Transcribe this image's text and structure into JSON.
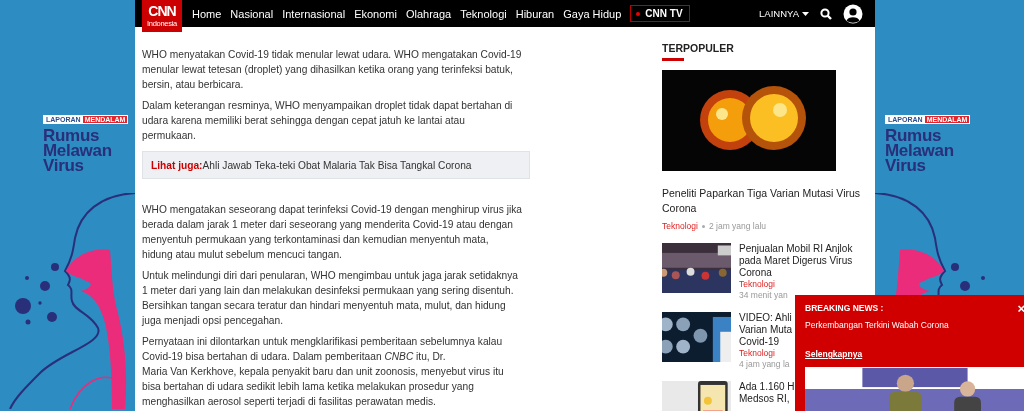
{
  "ad_left": {
    "badge": [
      "LAPORAN",
      "MENDALAM"
    ],
    "title": "Rumus\nMelawan\nVirus"
  },
  "nav": {
    "logo": {
      "brand": "CNN",
      "region": "Indonesia"
    },
    "items": [
      "Home",
      "Nasional",
      "Internasional",
      "Ekonomi",
      "Olahraga",
      "Teknologi",
      "Hiburan",
      "Gaya Hidup"
    ],
    "live": "CNN TV",
    "more": "LAINNYA"
  },
  "article": {
    "paragraphs_top": [
      "WHO menyatakan Covid-19 tidak menular lewat udara. WHO mengatakan Covid-19\nmenular lewat tetesan (droplet) yang dihasilkan ketika orang yang terinfeksi batuk,\nbersin, atau berbicara.",
      "Dalam keterangan resminya, WHO menyampaikan droplet  tidak dapat bertahan di\nudara karena memiliki berat sehingga dengan cepat jatuh ke lantai atau\npermukaan."
    ],
    "see_also": {
      "label": "Lihat juga:",
      "link": "Ahli Jawab Teka-teki Obat Malaria Tak Bisa Tangkal Corona"
    },
    "paragraphs_bottom": [
      "WHO mengatakan seseorang dapat terinfeksi Covid-19 dengan menghirup virus jika\nberada dalam jarak 1 meter dari seseorang yang menderita Covid-19 atau dengan\nmenyentuh permukaan yang terkontaminasi dan kemudian menyentuh mata,\nhidung atau mulut sebelum mencuci tangan.",
      "Untuk melindungi diri dari penularan, WHO mengimbau untuk jaga jarak setidaknya\n1 meter dari yang lain dan melakukan desinfeksi permukaan yang sering disentuh.\nBersihkan tangan secara teratur dan hindari menyentuh mata, mulut, dan hidung\njuga menjadi opsi pencegahan.",
      "Pernyataan ini dilontarkan untuk mengklarifikasi pemberitaan sebelumnya kalau\nCovid-19 bisa bertahan di udara. Dalam pemberitaan *CNBC* itu, Dr.\nMaria Van Kerkhove, kepala penyakit baru dan unit zoonosis, menyebut virus itu\nbisa bertahan di udara sedikit lebih lama ketika melakukan prosedur yang\nmenghasilkan aerosol seperti terjadi di fasilitas perawatan medis."
    ]
  },
  "popular": {
    "heading": "TERPOPULER",
    "top": {
      "title": "Peneliti Paparkan Tiga Varian Mutasi Virus\nCorona",
      "category": "Teknologi",
      "time": "2 jam yang lalu"
    },
    "items": [
      {
        "title": "Penjualan Mobil RI Anjlok\npada Maret Digerus Virus\nCorona",
        "category": "Teknologi",
        "time": "34 menit yan"
      },
      {
        "title": "VIDEO: Ahli\nVarian Muta\nCovid-19",
        "category": "Teknologi",
        "time": "4 jam yang la"
      },
      {
        "title": "Ada 1.160 H\nMedsos RI,"
      }
    ]
  },
  "ad_right": {
    "badge": [
      "LAPORAN",
      "MENDALAM"
    ],
    "title": "Rumus\nMelawan\nVirus"
  },
  "breaking": {
    "label": "BREAKING NEWS :",
    "close": "×",
    "headline": "Perkembangan Terkini Wabah Corona",
    "link": "Selengkapnya"
  }
}
